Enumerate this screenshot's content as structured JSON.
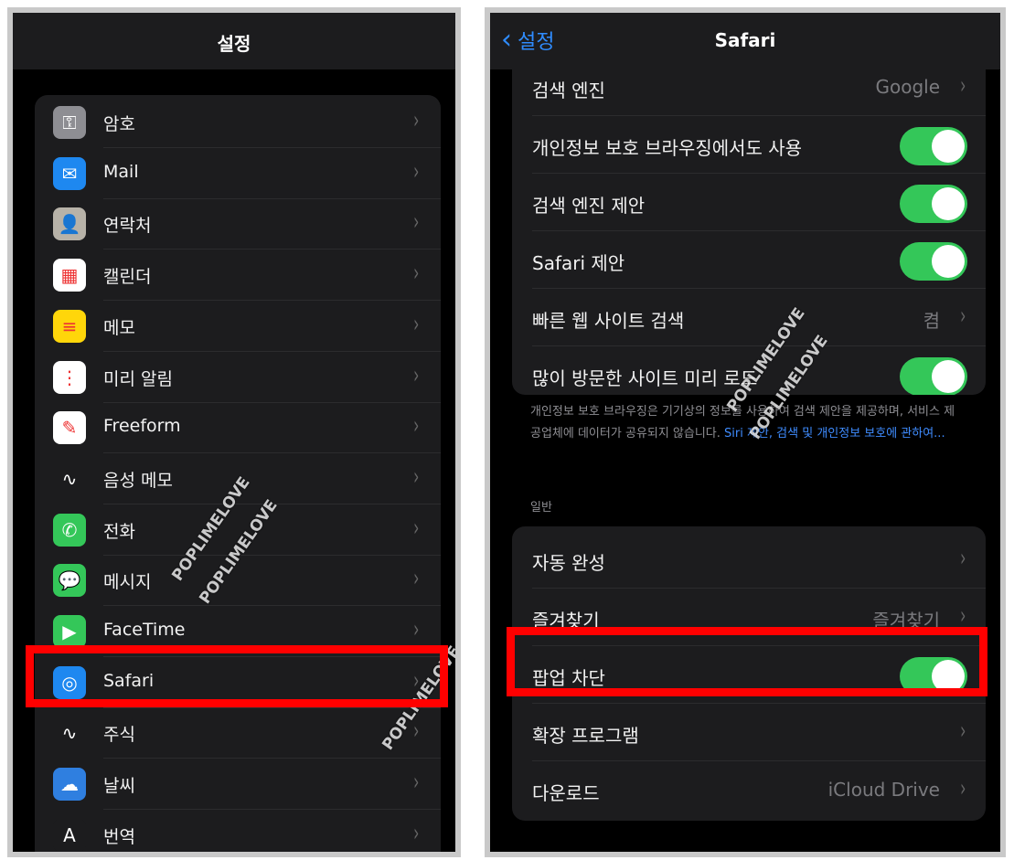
{
  "left": {
    "title": "설정",
    "items": [
      {
        "label": "암호",
        "icon": "key-icon",
        "color": "#8e8e93"
      },
      {
        "label": "Mail",
        "icon": "mail-icon",
        "color": "#1e88f0"
      },
      {
        "label": "연락처",
        "icon": "contacts-icon",
        "color": "#b7b2a8"
      },
      {
        "label": "캘린더",
        "icon": "calendar-icon",
        "color": "#ffffff"
      },
      {
        "label": "메모",
        "icon": "notes-icon",
        "color": "#ffd60a"
      },
      {
        "label": "미리 알림",
        "icon": "reminders-icon",
        "color": "#ffffff"
      },
      {
        "label": "Freeform",
        "icon": "freeform-icon",
        "color": "#ffffff"
      },
      {
        "label": "음성 메모",
        "icon": "voice-memo-icon",
        "color": "#1c1c1e"
      },
      {
        "label": "전화",
        "icon": "phone-icon",
        "color": "#34c759"
      },
      {
        "label": "메시지",
        "icon": "messages-icon",
        "color": "#34c759"
      },
      {
        "label": "FaceTime",
        "icon": "facetime-icon",
        "color": "#34c759"
      },
      {
        "label": "Safari",
        "icon": "safari-icon",
        "color": "#1e88f0"
      },
      {
        "label": "주식",
        "icon": "stocks-icon",
        "color": "#1c1c1e"
      },
      {
        "label": "날씨",
        "icon": "weather-icon",
        "color": "#2f7fe0"
      },
      {
        "label": "번역",
        "icon": "translate-icon",
        "color": "#1c1c1e"
      }
    ]
  },
  "right": {
    "back_label": "설정",
    "title": "Safari",
    "group1": [
      {
        "label": "검색 엔진",
        "value": "Google",
        "type": "chevron"
      },
      {
        "label": "개인정보 보호 브라우징에서도 사용",
        "type": "toggle",
        "on": true
      },
      {
        "label": "검색 엔진 제안",
        "type": "toggle",
        "on": true
      },
      {
        "label": "Safari 제안",
        "type": "toggle",
        "on": true
      },
      {
        "label": "빠른 웹 사이트 검색",
        "value": "켬",
        "type": "chevron"
      },
      {
        "label": "많이 방문한 사이트 미리 로드",
        "type": "toggle",
        "on": true
      }
    ],
    "footnote_text": "개인정보 보호 브라우징은 기기상의 정보를 사용하여 검색 제안을 제공하며, 서비스 제공업체에 데이터가 공유되지 않습니다.",
    "footnote_link": "Siri 제안, 검색 및 개인정보 보호에 관하여...",
    "section_header": "일반",
    "group2": [
      {
        "label": "자동 완성",
        "value": "",
        "type": "chevron"
      },
      {
        "label": "즐겨찾기",
        "value": "즐겨찾기",
        "type": "chevron"
      },
      {
        "label": "팝업 차단",
        "type": "toggle",
        "on": true
      },
      {
        "label": "확장 프로그램",
        "value": "",
        "type": "chevron"
      },
      {
        "label": "다운로드",
        "value": "iCloud Drive",
        "type": "chevron"
      }
    ]
  },
  "watermark": "POPLIMELOVE",
  "colors": {
    "highlight": "#ff0000",
    "toggle_on": "#34c759",
    "link": "#3f8cff"
  }
}
